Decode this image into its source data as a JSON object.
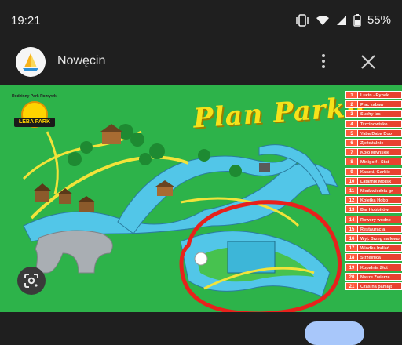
{
  "status_bar": {
    "time": "19:21",
    "battery": "55%",
    "icons": [
      "vibrate-icon",
      "wifi-icon",
      "signal-icon",
      "battery-icon"
    ]
  },
  "header": {
    "title": "Nowęcin",
    "avatar_icon": "sailboat-icon",
    "more_icon": "more-vert-icon",
    "close_icon": "close-icon"
  },
  "map": {
    "title": "Plan Parku",
    "logo_top": "Rodzinny Park Rozrywki",
    "logo_name": "ŁEBA PARK",
    "legend": [
      {
        "num": "1",
        "label": "Lucin - Rynek"
      },
      {
        "num": "2",
        "label": "Plac zabaw"
      },
      {
        "num": "3",
        "label": "Suchy las"
      },
      {
        "num": "4",
        "label": "Trzcinowisko"
      },
      {
        "num": "5",
        "label": "Yaba Daba Doo"
      },
      {
        "num": "6",
        "label": "Zjeżdżalnie"
      },
      {
        "num": "7",
        "label": "Koło Młyńskie"
      },
      {
        "num": "8",
        "label": "Minigolf - Stat"
      },
      {
        "num": "9",
        "label": "Kaczki, Garbie"
      },
      {
        "num": "10",
        "label": "Latarnik Morsk"
      },
      {
        "num": "11",
        "label": "Niedźwiedzia gr"
      },
      {
        "num": "12",
        "label": "Kolejka Hobb"
      },
      {
        "num": "13",
        "label": "Bar Hobbitów"
      },
      {
        "num": "14",
        "label": "Rowery wodne"
      },
      {
        "num": "15",
        "label": "Restauracja"
      },
      {
        "num": "16",
        "label": "Wyj. Brzeg na lewo"
      },
      {
        "num": "17",
        "label": "Wiodka Indiań"
      },
      {
        "num": "18",
        "label": "Strzelnica"
      },
      {
        "num": "19",
        "label": "Kopalnia Złot"
      },
      {
        "num": "20",
        "label": "Nasze Zwierzę"
      },
      {
        "num": "21",
        "label": "Czas na pamiąt"
      }
    ],
    "highlight_color": "#e8211c",
    "water_color": "#52c6e8",
    "grass_color": "#2db34a",
    "path_color": "#f2e33a"
  },
  "lens_icon": "lens-icon"
}
